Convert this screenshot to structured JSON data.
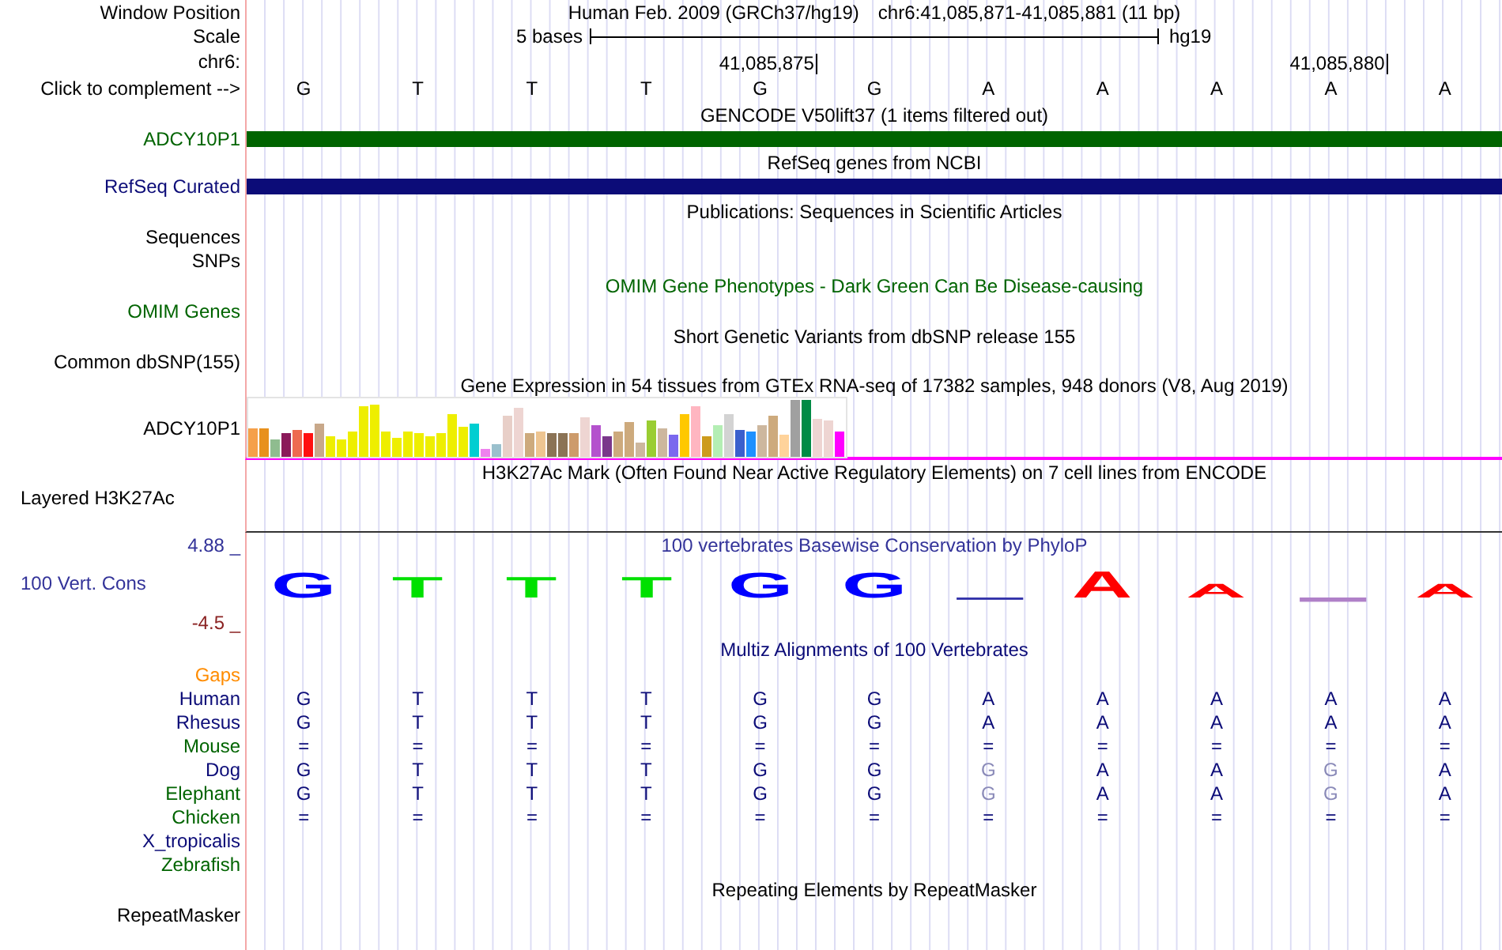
{
  "position": {
    "label": "Window Position",
    "assembly": "Human Feb. 2009 (GRCh37/hg19)",
    "range": "chr6:41,085,871-41,085,881 (11 bp)"
  },
  "scale": {
    "label": "Scale",
    "span": "5 bases",
    "assembly": "hg19"
  },
  "ruler": {
    "label": "chr6:"
  },
  "sequence": {
    "label": "Click to complement -->",
    "bases": [
      {
        "base": "G"
      },
      {
        "base": "T"
      },
      {
        "base": "T"
      },
      {
        "base": "T"
      },
      {
        "base": "G",
        "tick": "41,085,875"
      },
      {
        "base": "G"
      },
      {
        "base": "A"
      },
      {
        "base": "A"
      },
      {
        "base": "A"
      },
      {
        "base": "A",
        "tick": "41,085,880"
      },
      {
        "base": "A"
      }
    ]
  },
  "tracks": [
    {
      "kind": "gene",
      "title": {
        "text": "GENCODE V50lift37 (1 items filtered out)",
        "color": "#000000"
      },
      "label": "ADCY10P1",
      "color": "#006400"
    },
    {
      "kind": "gene",
      "title": {
        "text": "RefSeq genes from NCBI",
        "color": "#000000"
      },
      "label": "RefSeq Curated",
      "color": "#0c0c78"
    },
    {
      "kind": "text",
      "title": {
        "text": "Publications: Sequences in Scientific Articles",
        "color": "#000000"
      },
      "labels": [
        {
          "text": "Sequences",
          "color": "#000000"
        },
        {
          "text": "SNPs",
          "color": "#000000"
        }
      ]
    },
    {
      "kind": "text",
      "title": {
        "text": "OMIM Gene Phenotypes - Dark Green Can Be Disease-causing",
        "color": "#006400"
      },
      "labels": [
        {
          "text": "OMIM Genes",
          "color": "#006400"
        }
      ]
    },
    {
      "kind": "text",
      "title": {
        "text": "Short Genetic Variants from dbSNP release 155",
        "color": "#000000"
      },
      "labels": [
        {
          "text": "Common dbSNP(155)",
          "color": "#000000"
        }
      ]
    },
    {
      "kind": "expression",
      "title": {
        "text": "Gene Expression in 54 tissues from GTEx RNA-seq of 17382 samples, 948 donors (V8, Aug 2019)",
        "color": "#000000"
      },
      "label": "ADCY10P1"
    },
    {
      "kind": "signal",
      "title": {
        "text": "H3K27Ac Mark (Often Found Near Active Regulatory Elements) on 7 cell lines from ENCODE",
        "color": "#000000"
      },
      "label": "Layered H3K27Ac"
    },
    {
      "kind": "conservation",
      "title": {
        "text": "100 vertebrates Basewise Conservation by PhyloP",
        "color": "#333399"
      },
      "label": "100 Vert. Cons",
      "y_max": "4.88 _",
      "y_min": "-4.5 _",
      "logo": [
        {
          "kind": "letter",
          "base": "G",
          "color": "#0000ff"
        },
        {
          "kind": "letter",
          "base": "T",
          "color": "#00e000"
        },
        {
          "kind": "letter",
          "base": "T",
          "color": "#00e000"
        },
        {
          "kind": "letter",
          "base": "T",
          "color": "#00e000"
        },
        {
          "kind": "letter",
          "base": "G",
          "color": "#0000ff"
        },
        {
          "kind": "letter",
          "base": "G",
          "color": "#0000ff"
        },
        {
          "kind": "bar",
          "color": "#3333aa"
        },
        {
          "kind": "letter",
          "base": "A",
          "color": "#ff0000"
        },
        {
          "kind": "letter",
          "base": "A",
          "color": "#ff0000"
        },
        {
          "kind": "bar",
          "color": "#b080c8"
        },
        {
          "kind": "letter",
          "base": "A",
          "color": "#ff0000"
        }
      ]
    },
    {
      "kind": "alignment",
      "title": {
        "text": "Multiz Alignments of 100 Vertebrates",
        "color": "#0c0c78"
      },
      "gaps": {
        "label": "Gaps",
        "color": "#ff8c00"
      },
      "species": [
        {
          "name": "Human",
          "color": "#0c0c78",
          "bases": [
            {
              "base": "G",
              "faded": false
            },
            {
              "base": "T",
              "faded": false
            },
            {
              "base": "T",
              "faded": false
            },
            {
              "base": "T",
              "faded": false
            },
            {
              "base": "G",
              "faded": false
            },
            {
              "base": "G",
              "faded": false
            },
            {
              "base": "A",
              "faded": false
            },
            {
              "base": "A",
              "faded": false
            },
            {
              "base": "A",
              "faded": false
            },
            {
              "base": "A",
              "faded": false
            },
            {
              "base": "A",
              "faded": false
            }
          ]
        },
        {
          "name": "Rhesus",
          "color": "#0c0c78",
          "bases": [
            {
              "base": "G",
              "faded": false
            },
            {
              "base": "T",
              "faded": false
            },
            {
              "base": "T",
              "faded": false
            },
            {
              "base": "T",
              "faded": false
            },
            {
              "base": "G",
              "faded": false
            },
            {
              "base": "G",
              "faded": false
            },
            {
              "base": "A",
              "faded": false
            },
            {
              "base": "A",
              "faded": false
            },
            {
              "base": "A",
              "faded": false
            },
            {
              "base": "A",
              "faded": false
            },
            {
              "base": "A",
              "faded": false
            }
          ]
        },
        {
          "name": "Mouse",
          "color": "#006400",
          "bases": [
            {
              "base": "=",
              "faded": false
            },
            {
              "base": "=",
              "faded": false
            },
            {
              "base": "=",
              "faded": false
            },
            {
              "base": "=",
              "faded": false
            },
            {
              "base": "=",
              "faded": false
            },
            {
              "base": "=",
              "faded": false
            },
            {
              "base": "=",
              "faded": false
            },
            {
              "base": "=",
              "faded": false
            },
            {
              "base": "=",
              "faded": false
            },
            {
              "base": "=",
              "faded": false
            },
            {
              "base": "=",
              "faded": false
            }
          ]
        },
        {
          "name": "Dog",
          "color": "#0c0c78",
          "bases": [
            {
              "base": "G",
              "faded": false
            },
            {
              "base": "T",
              "faded": false
            },
            {
              "base": "T",
              "faded": false
            },
            {
              "base": "T",
              "faded": false
            },
            {
              "base": "G",
              "faded": false
            },
            {
              "base": "G",
              "faded": false
            },
            {
              "base": "G",
              "faded": true
            },
            {
              "base": "A",
              "faded": false
            },
            {
              "base": "A",
              "faded": false
            },
            {
              "base": "G",
              "faded": true
            },
            {
              "base": "A",
              "faded": false
            }
          ]
        },
        {
          "name": "Elephant",
          "color": "#006400",
          "bases": [
            {
              "base": "G",
              "faded": false
            },
            {
              "base": "T",
              "faded": false
            },
            {
              "base": "T",
              "faded": false
            },
            {
              "base": "T",
              "faded": false
            },
            {
              "base": "G",
              "faded": false
            },
            {
              "base": "G",
              "faded": false
            },
            {
              "base": "G",
              "faded": true
            },
            {
              "base": "A",
              "faded": false
            },
            {
              "base": "A",
              "faded": false
            },
            {
              "base": "G",
              "faded": true
            },
            {
              "base": "A",
              "faded": false
            }
          ]
        },
        {
          "name": "Chicken",
          "color": "#006400",
          "bases": [
            {
              "base": "=",
              "faded": false
            },
            {
              "base": "=",
              "faded": false
            },
            {
              "base": "=",
              "faded": false
            },
            {
              "base": "=",
              "faded": false
            },
            {
              "base": "=",
              "faded": false
            },
            {
              "base": "=",
              "faded": false
            },
            {
              "base": "=",
              "faded": false
            },
            {
              "base": "=",
              "faded": false
            },
            {
              "base": "=",
              "faded": false
            },
            {
              "base": "=",
              "faded": false
            },
            {
              "base": "=",
              "faded": false
            }
          ]
        },
        {
          "name": "X_tropicalis",
          "color": "#0c0c78"
        },
        {
          "name": "Zebrafish",
          "color": "#006400"
        }
      ]
    },
    {
      "kind": "text",
      "title": {
        "text": "Repeating Elements by RepeatMasker",
        "color": "#000000"
      },
      "labels": [
        {
          "text": "RepeatMasker",
          "color": "#000000"
        }
      ]
    }
  ]
}
